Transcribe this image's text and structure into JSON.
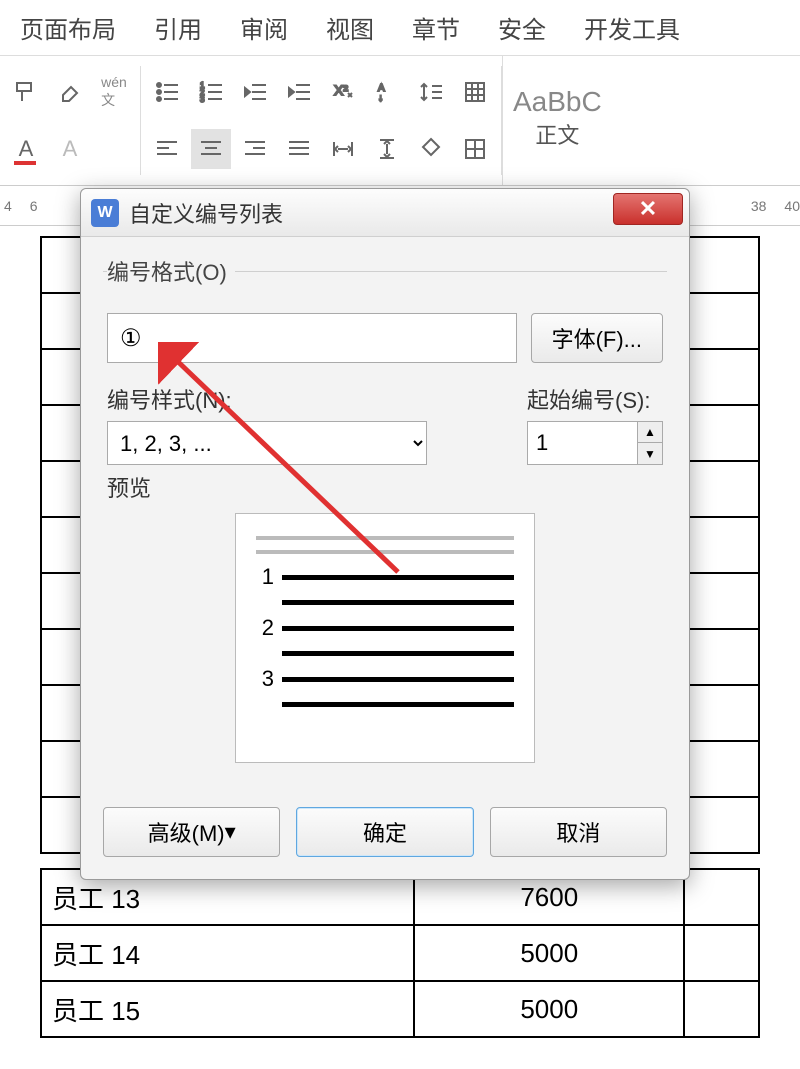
{
  "menu": {
    "items": [
      "页面布局",
      "引用",
      "审阅",
      "视图",
      "章节",
      "安全",
      "开发工具"
    ]
  },
  "ribbon": {
    "style_sample": "AaBbC",
    "style_name": "正文"
  },
  "ruler": {
    "marks": [
      "4",
      "6",
      "",
      "",
      "",
      "",
      "",
      "",
      "",
      "",
      "",
      "",
      "",
      "",
      "",
      "",
      "",
      "38",
      "40"
    ]
  },
  "dialog": {
    "title": "自定义编号列表",
    "groupbox_label": "编号格式(O)",
    "format_value": "①",
    "font_btn": "字体(F)...",
    "style_label": "编号样式(N):",
    "style_value": "1, 2, 3, ...",
    "start_label": "起始编号(S):",
    "start_value": "1",
    "preview_label": "预览",
    "preview_nums": [
      "1",
      "2",
      "3"
    ],
    "advanced_btn": "高级(M) ",
    "ok_btn": "确定",
    "cancel_btn": "取消"
  },
  "table": {
    "rows": [
      {
        "name": "员工 13",
        "val": "7600"
      },
      {
        "name": "员工 14",
        "val": "5000"
      },
      {
        "name": "员工 15",
        "val": "5000"
      }
    ]
  }
}
